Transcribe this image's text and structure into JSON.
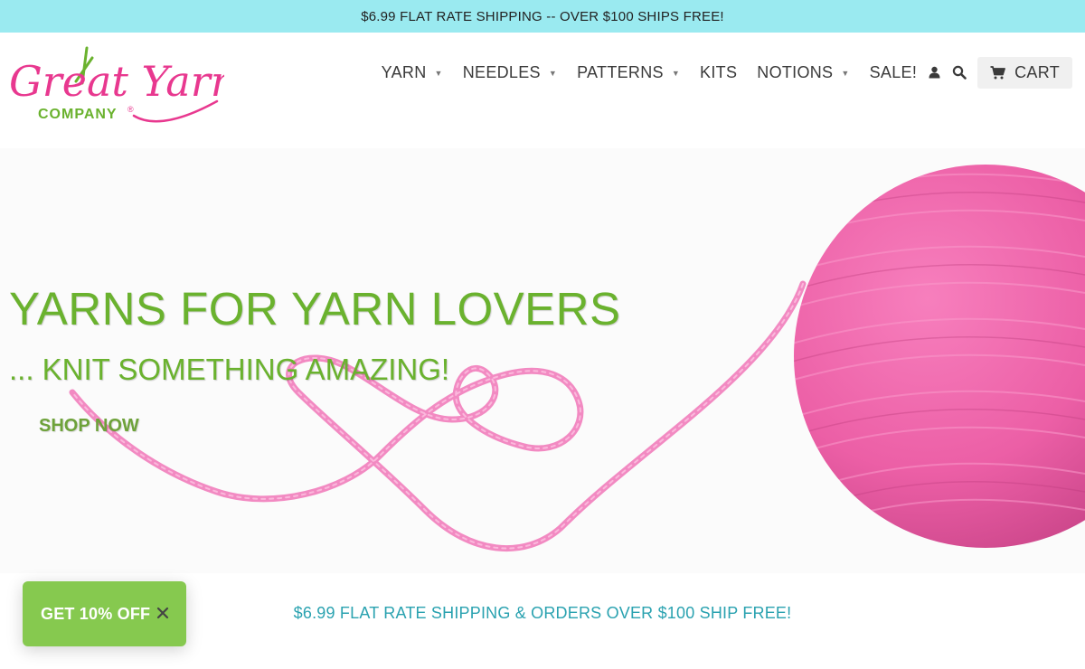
{
  "announcement": {
    "text": "$6.99 FLAT RATE SHIPPING -- OVER $100 SHIPS FREE!"
  },
  "brand": {
    "logo_script": "Great Yarn",
    "logo_sub": "COMPANY",
    "logo_mark": "®",
    "pink": "#e8388f",
    "green": "#6ab22e"
  },
  "nav": {
    "items": [
      {
        "label": "YARN",
        "has_dropdown": true
      },
      {
        "label": "NEEDLES",
        "has_dropdown": true
      },
      {
        "label": "PATTERNS",
        "has_dropdown": true
      },
      {
        "label": "KITS",
        "has_dropdown": false
      },
      {
        "label": "NOTIONS",
        "has_dropdown": true
      },
      {
        "label": "SALE!",
        "has_dropdown": false
      }
    ],
    "dropdown_glyph": "▼",
    "account_icon": "user-icon",
    "search_icon": "search-icon",
    "cart_label": "CART",
    "cart_icon": "cart-icon"
  },
  "hero": {
    "title": "YARNS FOR YARN LOVERS",
    "subtitle": "... KNIT SOMETHING AMAZING!",
    "cta": "SHOP NOW",
    "yarn_color": "#f06bb0"
  },
  "shipping_message": "$6.99 FLAT RATE SHIPPING & ORDERS OVER $100 SHIP FREE!",
  "discount_popup": {
    "label": "GET 10% OFF",
    "close_icon": "close-icon",
    "color": "#86c94f"
  }
}
